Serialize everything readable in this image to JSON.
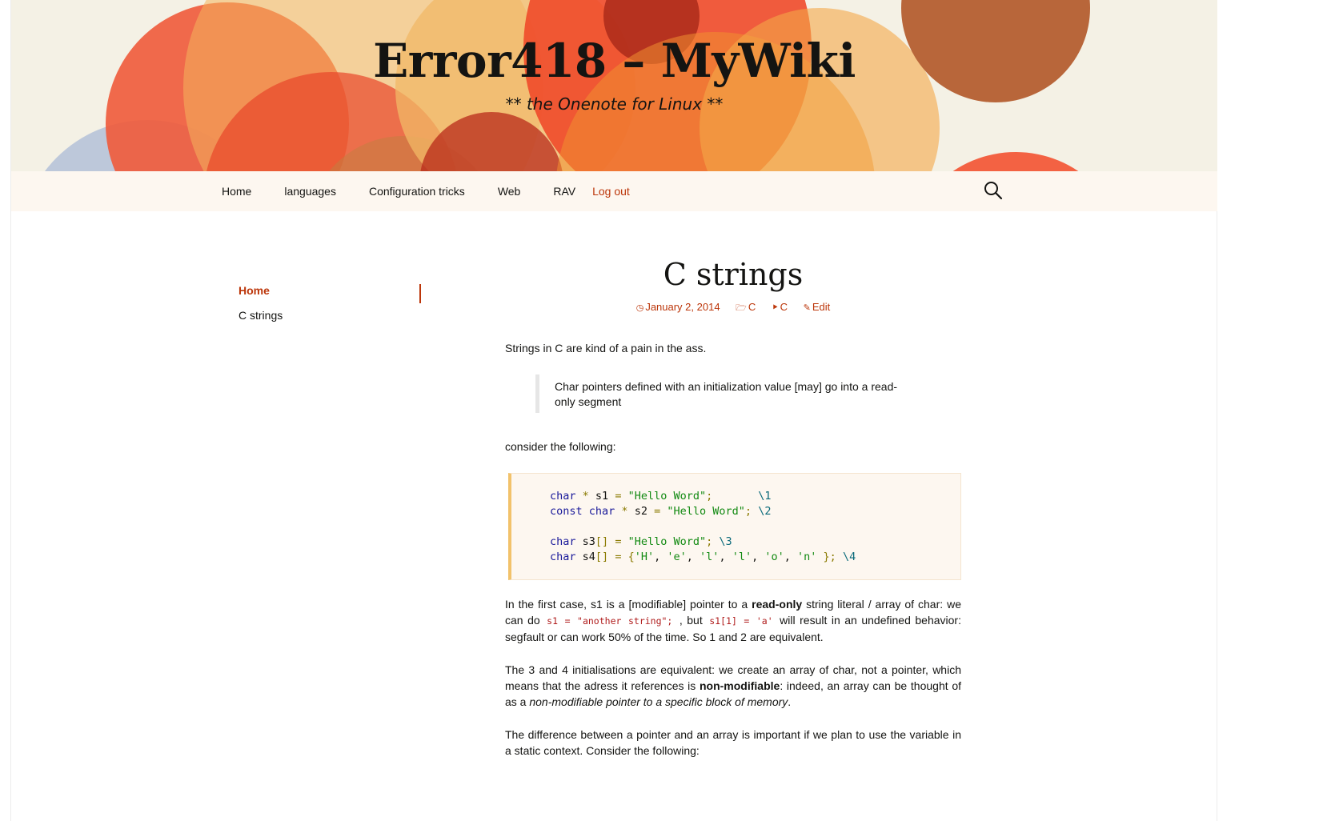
{
  "header": {
    "site_title": "Error418 – MyWiki",
    "tagline": "** the Onenote for Linux **"
  },
  "nav": {
    "items": [
      {
        "label": "Home"
      },
      {
        "label": "languages"
      },
      {
        "label": "Configuration tricks"
      },
      {
        "label": "Web"
      },
      {
        "label": "RAV"
      }
    ],
    "logout_label": "Log out",
    "search_icon": "search-icon"
  },
  "sidebar": {
    "items": [
      {
        "label": "Home",
        "current": true
      },
      {
        "label": "C strings",
        "current": false
      }
    ]
  },
  "post": {
    "title": "C strings",
    "meta": {
      "date": "January 2, 2014",
      "category": "C",
      "tag": "C",
      "edit_label": "Edit"
    },
    "intro": "Strings in C are kind of a pain in the ass.",
    "quote": "Char pointers defined with an initialization value [may] go into a read-only segment",
    "consider": "consider the following:",
    "code_lines": [
      "char * s1 = \"Hello Word\";       \\1",
      "const char * s2 = \"Hello Word\"; \\2",
      "",
      "char s3[] = \"Hello Word\"; \\3",
      "char s4[] = {'H', 'e', 'l', 'l', 'o', 'n' }; \\4"
    ],
    "para1": {
      "t1": "In the first case, s1 is a [modifiable] pointer to a ",
      "b1": "read-only",
      "t2": " string literal / array of char: we can do ",
      "code1": "s1 = \"another string\";",
      "t3": " , but ",
      "code2": "s1[1] = 'a'",
      "t4": " will result in an undefined behavior: segfault or can work 50% of the time. So 1 and 2 are equivalent."
    },
    "para2": {
      "t1": "The 3 and 4 initialisations are equivalent: we create an array of char, not a pointer, which means that the adress it references is ",
      "b1": "non-modifiable",
      "t2": ": indeed, an array can be thought of as a ",
      "i1": "non-modifiable pointer to a specific block of memory",
      "t3": "."
    },
    "para3": "The difference between a pointer and an array is important if we plan to use the variable in a static context. Consider the following:"
  },
  "colors": {
    "accent": "#bc360a",
    "header_bg": "#f4f1e5",
    "nav_bg": "#fdf7f0"
  }
}
